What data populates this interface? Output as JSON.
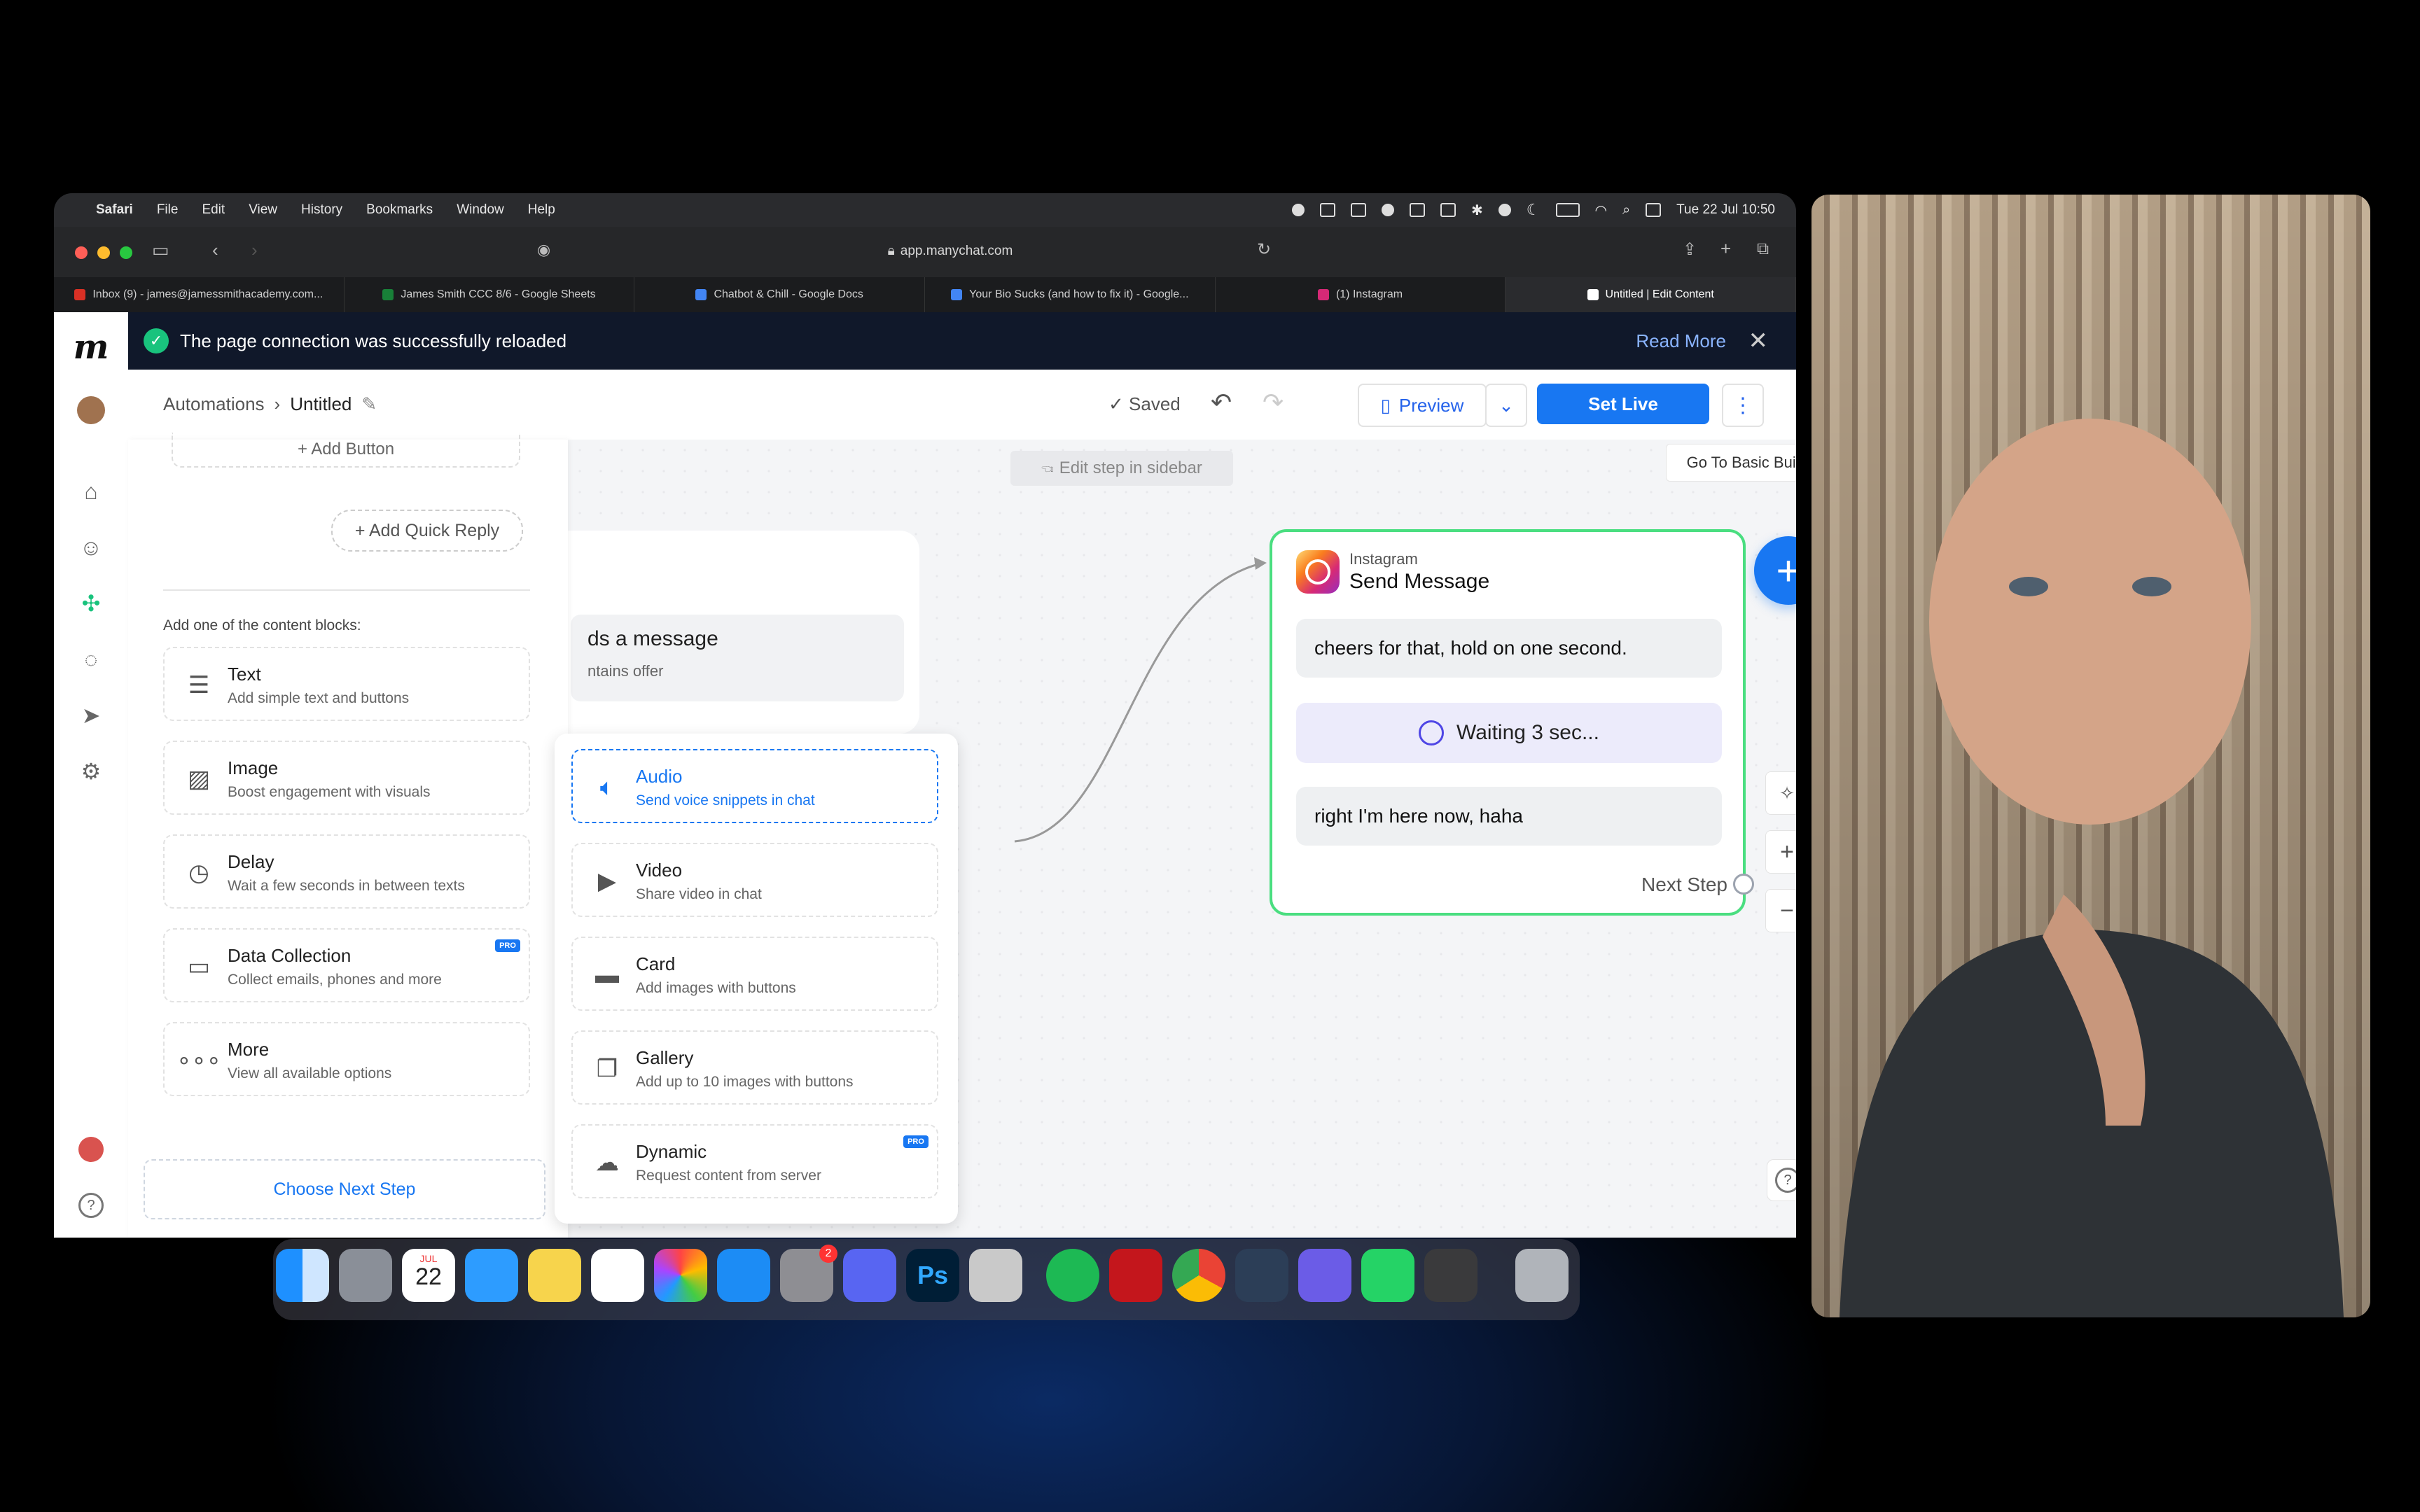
{
  "menubar": {
    "app": "Safari",
    "items": [
      "File",
      "Edit",
      "View",
      "History",
      "Bookmarks",
      "Window",
      "Help"
    ],
    "clock": "Tue 22 Jul 10:50"
  },
  "browser": {
    "url": "app.manychat.com",
    "tabs": [
      {
        "label": "Inbox (9) - james@jamessmithacademy.com...",
        "color": "#d93025"
      },
      {
        "label": "James Smith CCC 8/6 - Google Sheets",
        "color": "#188038"
      },
      {
        "label": "Chatbot & Chill - Google Docs",
        "color": "#4285f4"
      },
      {
        "label": "Your Bio Sucks (and how to fix it) - Google...",
        "color": "#4285f4"
      },
      {
        "label": "(1) Instagram",
        "color": "#d62976"
      },
      {
        "label": "Untitled | Edit Content",
        "color": "#ffffff"
      }
    ]
  },
  "banner": {
    "message": "The page connection was successfully reloaded",
    "read_more": "Read More"
  },
  "header": {
    "breadcrumb_root": "Automations",
    "breadcrumb_current": "Untitled",
    "saved": "Saved",
    "preview": "Preview",
    "set_live": "Set Live"
  },
  "canvas": {
    "hint": "Edit step in sidebar",
    "basic_builder": "Go To Basic Builder",
    "trigger_title": "ds a message",
    "trigger_sub": "ntains offer",
    "node": {
      "platform": "Instagram",
      "title": "Send Message",
      "message1": "cheers for that, hold on one second.",
      "wait": "Waiting 3 sec...",
      "message2": "right I'm here now, haha",
      "next_step": "Next Step"
    }
  },
  "sidebar": {
    "add_button": "+ Add Button",
    "quick_reply": "+ Add Quick Reply",
    "add_label": "Add one of the content blocks:",
    "blocks": [
      {
        "title": "Text",
        "sub": "Add simple text and buttons",
        "icon": "text-lines-icon"
      },
      {
        "title": "Image",
        "sub": "Boost engagement with visuals",
        "icon": "image-icon"
      },
      {
        "title": "Delay",
        "sub": "Wait a few seconds in between texts",
        "icon": "clock-icon"
      },
      {
        "title": "Data Collection",
        "sub": "Collect emails, phones and more",
        "icon": "input-field-icon",
        "pro": "PRO"
      },
      {
        "title": "More",
        "sub": "View all available options",
        "icon": "more-dots-icon"
      }
    ],
    "choose_next": "Choose Next Step"
  },
  "popup": {
    "blocks": [
      {
        "title": "Audio",
        "sub": "Send voice snippets in chat",
        "icon": "speaker-icon"
      },
      {
        "title": "Video",
        "sub": "Share video in chat",
        "icon": "video-icon"
      },
      {
        "title": "Card",
        "sub": "Add images with buttons",
        "icon": "card-icon"
      },
      {
        "title": "Gallery",
        "sub": "Add up to 10 images with buttons",
        "icon": "gallery-icon"
      },
      {
        "title": "Dynamic",
        "sub": "Request content from server",
        "icon": "cloud-icon",
        "pro": "PRO"
      }
    ]
  },
  "dock": {
    "calendar_month": "JUL",
    "calendar_day": "22",
    "settings_badge": "2"
  },
  "colors": {
    "accent": "#1877f2",
    "node_border": "#4ade80",
    "banner_bg": "#10182a"
  }
}
